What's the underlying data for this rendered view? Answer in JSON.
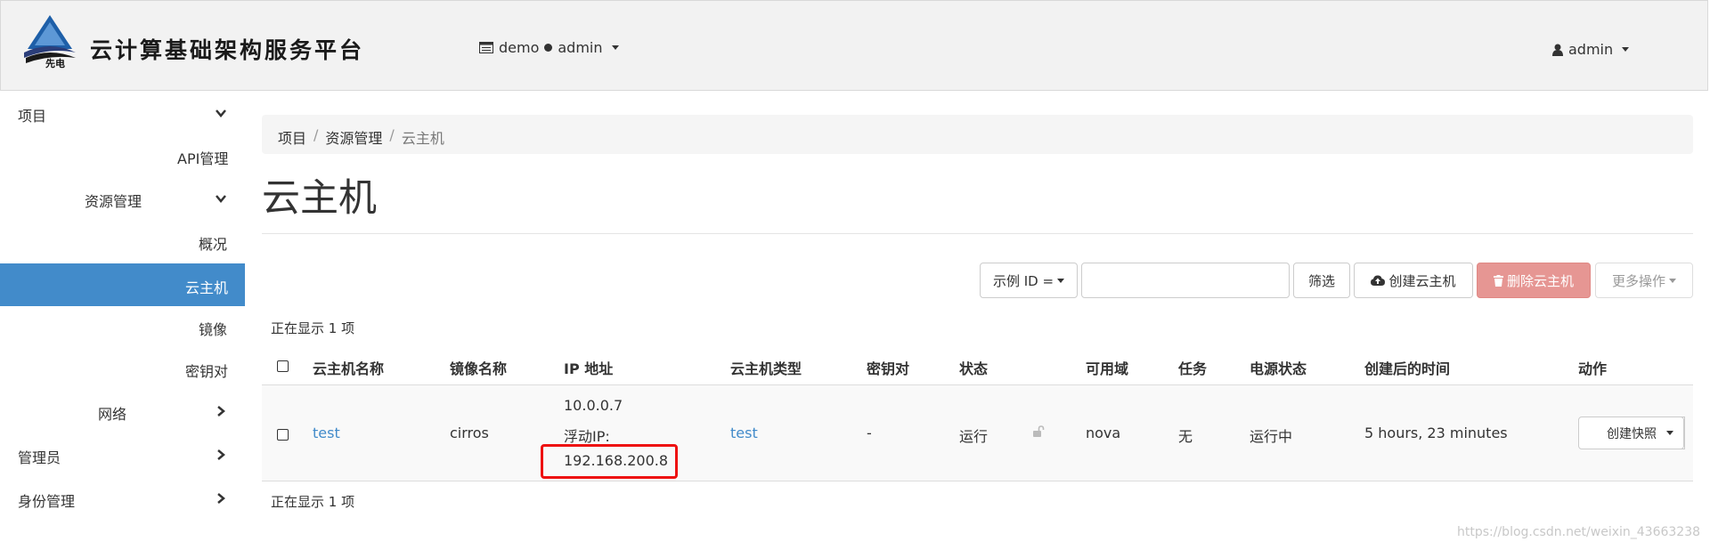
{
  "header": {
    "logo_title": "云计算基础架构服务平台",
    "logo_caption": "先电",
    "project_label": "demo",
    "project_user": "admin",
    "user_label": "admin"
  },
  "sidebar": {
    "items": [
      {
        "label": "项目"
      },
      {
        "label": "API管理"
      },
      {
        "label": "资源管理"
      },
      {
        "label": "概况"
      },
      {
        "label": "云主机"
      },
      {
        "label": "镜像"
      },
      {
        "label": "密钥对"
      },
      {
        "label": "网络"
      },
      {
        "label": "管理员"
      },
      {
        "label": "身份管理"
      }
    ]
  },
  "breadcrumb": [
    "项目",
    "资源管理",
    "云主机"
  ],
  "page_title": "云主机",
  "toolbar": {
    "filter_field": "示例 ID =",
    "filter_button": "筛选",
    "create_button": "创建云主机",
    "delete_button": "删除云主机",
    "more_button": "更多操作"
  },
  "count_text": "正在显示 1 项",
  "table": {
    "columns": [
      "云主机名称",
      "镜像名称",
      "IP 地址",
      "云主机类型",
      "密钥对",
      "状态",
      "可用域",
      "任务",
      "电源状态",
      "创建后的时间",
      "动作"
    ],
    "rows": [
      {
        "name": "test",
        "image": "cirros",
        "ip_fixed": "10.0.0.7",
        "ip_floating_label": "浮动IP:",
        "ip_floating": "192.168.200.8",
        "flavor": "test",
        "keypair": "-",
        "status": "运行",
        "zone": "nova",
        "task": "无",
        "power": "运行中",
        "age": "5 hours, 23 minutes",
        "action": "创建快照"
      }
    ]
  },
  "watermark": "https://blog.csdn.net/weixin_43663238",
  "colors": {
    "accent": "#428bca",
    "danger": "#e69693",
    "highlight_box": "#ee1111"
  }
}
